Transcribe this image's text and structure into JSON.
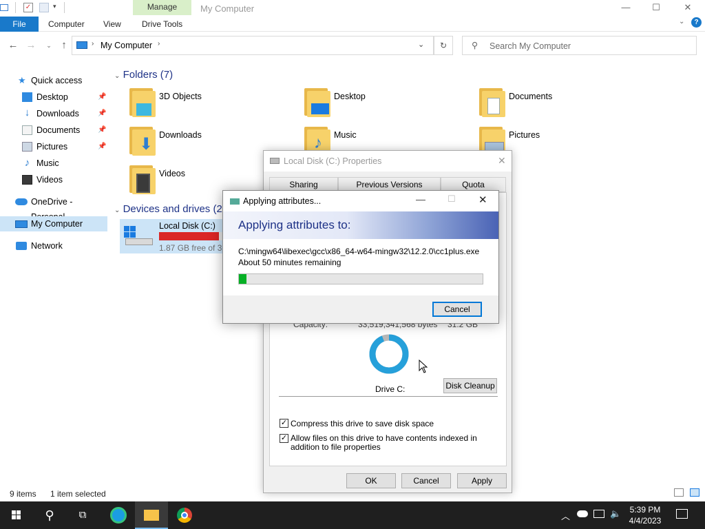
{
  "window": {
    "title": "My Computer",
    "contextual_tab": "Manage",
    "controls": {
      "minimize": "—",
      "maximize": "☐",
      "close": "✕"
    }
  },
  "ribbon": {
    "file": "File",
    "tabs": [
      "Computer",
      "View",
      "Drive Tools"
    ]
  },
  "address": {
    "path": "My Computer",
    "search_placeholder": "Search My Computer"
  },
  "nav_pane": {
    "quick_access": "Quick access",
    "items": [
      {
        "label": "Desktop",
        "icon": "desktop-icon",
        "pinned": true
      },
      {
        "label": "Downloads",
        "icon": "downloads-icon",
        "pinned": true
      },
      {
        "label": "Documents",
        "icon": "documents-icon",
        "pinned": true
      },
      {
        "label": "Pictures",
        "icon": "pictures-icon",
        "pinned": true
      },
      {
        "label": "Music",
        "icon": "music-icon",
        "pinned": false
      },
      {
        "label": "Videos",
        "icon": "videos-icon",
        "pinned": false
      }
    ],
    "onedrive": "OneDrive - Personal",
    "my_computer": "My Computer",
    "network": "Network"
  },
  "content": {
    "folders_header": "Folders (7)",
    "folders": [
      {
        "name": "3D Objects",
        "icon": "3d-objects-icon"
      },
      {
        "name": "Desktop",
        "icon": "desktop-icon"
      },
      {
        "name": "Documents",
        "icon": "documents-icon"
      },
      {
        "name": "Downloads",
        "icon": "downloads-icon"
      },
      {
        "name": "Music",
        "icon": "music-icon"
      },
      {
        "name": "Pictures",
        "icon": "pictures-icon"
      },
      {
        "name": "Videos",
        "icon": "videos-icon"
      }
    ],
    "drives_header": "Devices and drives (2",
    "drive": {
      "name": "Local Disk (C:)",
      "free": "1.87 GB free of 31",
      "used_fraction": 0.94
    }
  },
  "status_bar": {
    "items_count": "9 items",
    "selected": "1 item selected"
  },
  "properties_dialog": {
    "title": "Local Disk (C:) Properties",
    "tabs": [
      "Sharing",
      "Previous Versions",
      "Quota"
    ],
    "capacity_label": "Capacity:",
    "capacity_bytes": "33,519,341,568 bytes",
    "capacity_gb": "31.2 GB",
    "drive_label": "Drive C:",
    "disk_cleanup": "Disk Cleanup",
    "compress": {
      "label": "Compress this drive to save disk space",
      "checked": true
    },
    "index": {
      "label": "Allow files on this drive to have contents indexed in addition to file properties",
      "checked": true
    },
    "buttons": {
      "ok": "OK",
      "cancel": "Cancel",
      "apply": "Apply"
    },
    "used_fraction": 0.94
  },
  "apply_dialog": {
    "title": "Applying attributes...",
    "heading": "Applying attributes to:",
    "file_path": "C:\\mingw64\\libexec\\gcc\\x86_64-w64-mingw32\\12.2.0\\cc1plus.exe",
    "time_remaining": "About 50 minutes remaining",
    "progress_fraction": 0.03,
    "cancel": "Cancel"
  },
  "taskbar": {
    "time": "5:39 PM",
    "date": "4/4/2023",
    "apps": [
      "start-icon",
      "search-icon",
      "task-view-icon",
      "edge-icon",
      "file-explorer-icon",
      "chrome-icon"
    ]
  }
}
